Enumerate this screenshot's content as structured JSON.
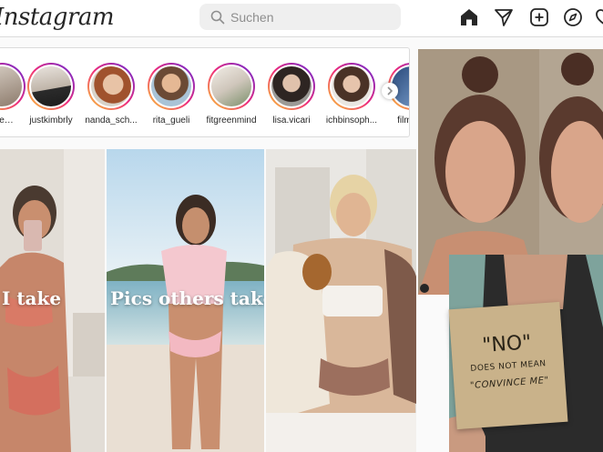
{
  "app": {
    "logo_text": "Instagram"
  },
  "search": {
    "placeholder": "Suchen"
  },
  "nav": {
    "icons": [
      "home-icon",
      "direct-icon",
      "new-post-icon",
      "explore-icon",
      "activity-icon"
    ]
  },
  "stories": {
    "items": [
      {
        "username": "…e…"
      },
      {
        "username": "justkimbrly"
      },
      {
        "username": "nanda_sch..."
      },
      {
        "username": "rita_gueli"
      },
      {
        "username": "fitgreenmind"
      },
      {
        "username": "lisa.vicari"
      },
      {
        "username": "ichbinsoph..."
      },
      {
        "username": "filmst..."
      }
    ]
  },
  "collage": {
    "caption_left": "I take",
    "caption_right": "Pics others take",
    "sign_line1": "\"NO\"",
    "sign_line2": "DOES NOT MEAN",
    "sign_line3": "\"CONVINCE ME\""
  },
  "colors": {
    "ring_start": "#f9ce34",
    "ring_mid": "#ee2a7b",
    "ring_end": "#6228d7",
    "border": "#dbdbdb"
  }
}
